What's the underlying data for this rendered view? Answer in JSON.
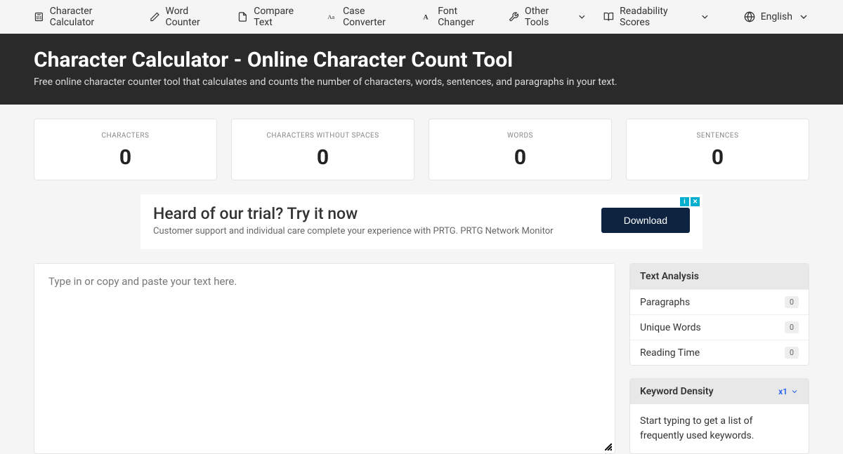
{
  "nav": {
    "items": [
      {
        "label": "Character Calculator"
      },
      {
        "label": "Word Counter"
      },
      {
        "label": "Compare Text"
      },
      {
        "label": "Case Converter"
      },
      {
        "label": "Font Changer"
      },
      {
        "label": "Other Tools"
      },
      {
        "label": "Readability Scores"
      }
    ],
    "language": "English"
  },
  "hero": {
    "title": "Character Calculator - Online Character Count Tool",
    "subtitle": "Free online character counter tool that calculates and counts the number of characters, words, sentences, and paragraphs in your text."
  },
  "stats": [
    {
      "label": "CHARACTERS",
      "value": "0"
    },
    {
      "label": "CHARACTERS WITHOUT SPACES",
      "value": "0"
    },
    {
      "label": "WORDS",
      "value": "0"
    },
    {
      "label": "SENTENCES",
      "value": "0"
    }
  ],
  "ad": {
    "title": "Heard of our trial? Try it now",
    "subtitle": "Customer support and individual care complete your experience with PRTG. PRTG Network Monitor",
    "button": "Download"
  },
  "textarea": {
    "placeholder": "Type in or copy and paste your text here."
  },
  "analysis": {
    "title": "Text Analysis",
    "rows": [
      {
        "label": "Paragraphs",
        "value": "0"
      },
      {
        "label": "Unique Words",
        "value": "0"
      },
      {
        "label": "Reading Time",
        "value": "0"
      }
    ]
  },
  "keyword": {
    "title": "Keyword Density",
    "multiplier": "x1",
    "body": "Start typing to get a list of frequently used keywords."
  }
}
